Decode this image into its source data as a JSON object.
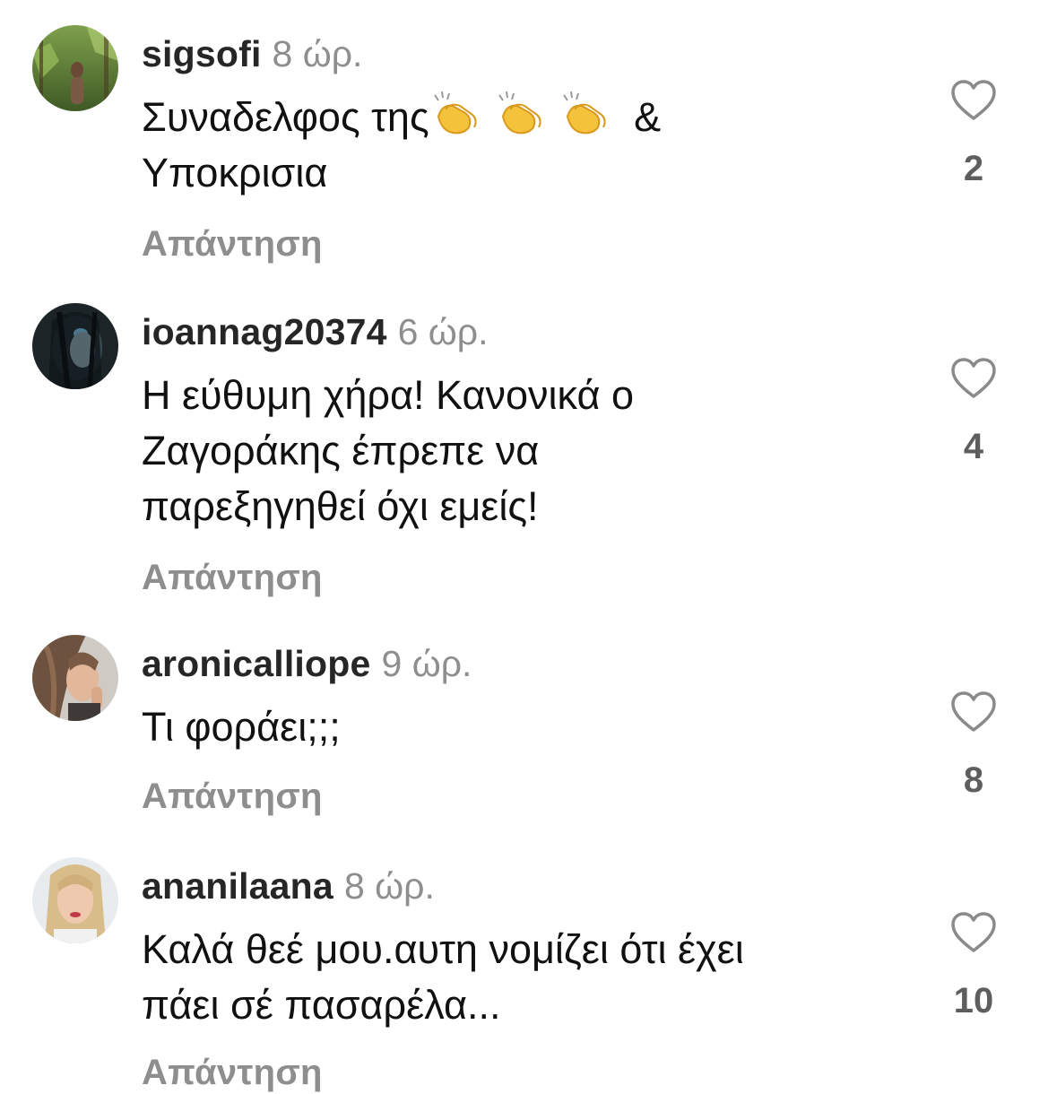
{
  "comments": [
    {
      "username": "sigsofi",
      "time": "8 ώρ.",
      "text_lines": [
        "Συναδελφος της",
        "Υποκρισια"
      ],
      "text_suffix": "&",
      "emoji": [
        "clapping-hands",
        "clapping-hands",
        "clapping-hands"
      ],
      "reply_label": "Απάντηση",
      "likes": "2"
    },
    {
      "username": "ioannag20374",
      "time": "6 ώρ.",
      "text_lines": [
        "Η εύθυμη χήρα! Κανονικά ο",
        "Ζαγοράκης έπρεπε να",
        "παρεξηγηθεί όχι εμείς!"
      ],
      "reply_label": "Απάντηση",
      "likes": "4"
    },
    {
      "username": "aronicalliope",
      "time": "9 ώρ.",
      "text_lines": [
        "Τι φοράει;;;"
      ],
      "reply_label": "Απάντηση",
      "likes": "8"
    },
    {
      "username": "ananilaana",
      "time": "8 ώρ.",
      "text_lines": [
        "Καλά θεέ μου.αυτη νομίζει ότι έχει",
        "πάει σέ πασαρέλα..."
      ],
      "reply_label": "Απάντηση",
      "likes": "10"
    }
  ],
  "icons": {
    "like": "heart-outline-icon",
    "avatar": "profile-photo"
  },
  "colors": {
    "text": "#111111",
    "username": "#262626",
    "secondary": "#8e8e8e",
    "like_count": "#5e5e5e",
    "emoji": "#f5c33b"
  }
}
